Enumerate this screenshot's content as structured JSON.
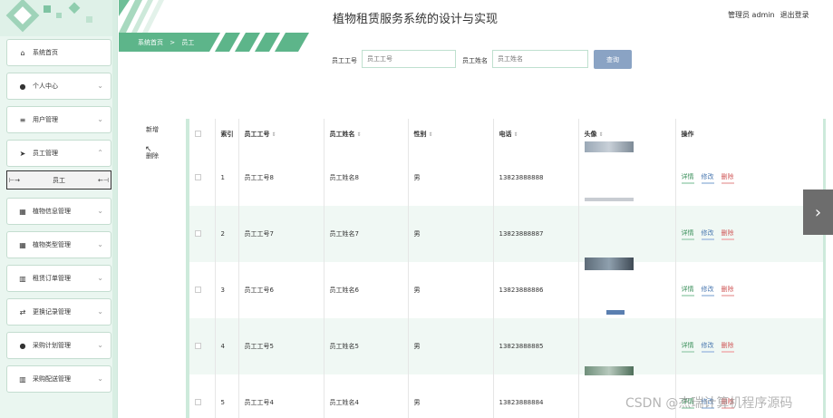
{
  "header": {
    "title": "植物租赁服务系统的设计与实现",
    "user_label": "管理员 admin",
    "logout": "退出登录"
  },
  "breadcrumb": {
    "home": "系统首页",
    "separator": ">",
    "current": "员工"
  },
  "sidebar": {
    "items": [
      {
        "label": "系统首页",
        "icon": "home-icon"
      },
      {
        "label": "个人中心",
        "icon": "user-icon"
      },
      {
        "label": "用户管理",
        "icon": "list-icon"
      },
      {
        "label": "员工管理",
        "icon": "send-icon"
      },
      {
        "label": "植物信息管理",
        "icon": "grid-icon"
      },
      {
        "label": "植物类型管理",
        "icon": "grid-icon"
      },
      {
        "label": "租赁订单管理",
        "icon": "chart-icon"
      },
      {
        "label": "更换记录管理",
        "icon": "swap-icon"
      },
      {
        "label": "采购计划管理",
        "icon": "user-icon"
      },
      {
        "label": "采购配送管理",
        "icon": "chart-icon"
      }
    ],
    "sub_item": "员工"
  },
  "search": {
    "emp_no_label": "员工工号",
    "emp_no_placeholder": "员工工号",
    "emp_name_label": "员工姓名",
    "emp_name_placeholder": "员工姓名",
    "button": "查询"
  },
  "actions": {
    "add": "新增",
    "delete": "删除"
  },
  "table": {
    "headers": [
      "",
      "索引",
      "员工工号",
      "员工姓名",
      "性别",
      "电话",
      "头像",
      "操作"
    ],
    "ops": {
      "detail": "详情",
      "edit": "修改",
      "delete": "删除"
    },
    "rows": [
      {
        "idx": "1",
        "no": "员工工号8",
        "name": "员工姓名8",
        "gender": "男",
        "phone": "13823888888"
      },
      {
        "idx": "2",
        "no": "员工工号7",
        "name": "员工姓名7",
        "gender": "男",
        "phone": "13823888887"
      },
      {
        "idx": "3",
        "no": "员工工号6",
        "name": "员工姓名6",
        "gender": "男",
        "phone": "13823888886"
      },
      {
        "idx": "4",
        "no": "员工工号5",
        "name": "员工姓名5",
        "gender": "男",
        "phone": "13823888885"
      },
      {
        "idx": "5",
        "no": "员工工号4",
        "name": "员工姓名4",
        "gender": "男",
        "phone": "13823888884"
      }
    ]
  },
  "watermark": "CSDN @杰瑞计算机程序源码",
  "colors": {
    "accent": "#4caf84",
    "sidebar_bg": "#eaf6f0",
    "search_btn": "#8aa3c4"
  }
}
